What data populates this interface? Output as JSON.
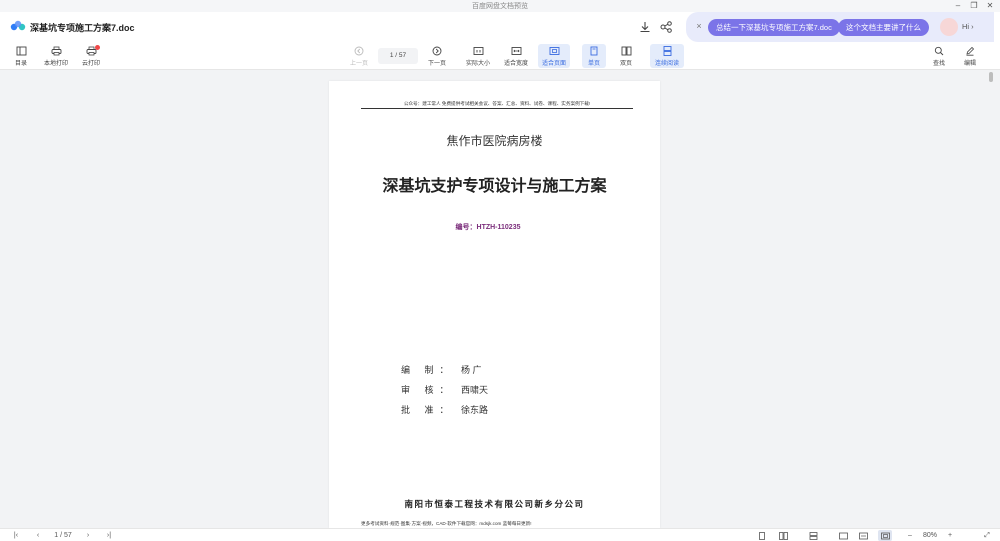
{
  "window": {
    "title": "百度网盘文档预览",
    "controls": {
      "minimize": "–",
      "restore": "❐",
      "close": "✕"
    }
  },
  "header": {
    "doc_title": "深基坑专项施工方案7.doc",
    "download_icon": "download-icon",
    "share_icon": "share-icon"
  },
  "ai": {
    "close": "×",
    "chip_summary": "总结一下深基坑专项施工方案7.doc",
    "chip_ask": "这个文档主要讲了什么",
    "hi": "Hi ›"
  },
  "toolbar": {
    "toc": "目录",
    "local_print": "本地打印",
    "cloud_print": "云打印",
    "prev_page": "上一页",
    "page_indicator": "1  /  57",
    "next_page": "下一页",
    "actual_size": "实际大小",
    "fit_width": "适合宽度",
    "fit_page": "适合页面",
    "single_page": "单页",
    "double_page": "双页",
    "continuous": "连续阅读",
    "find": "查找",
    "edit": "编辑"
  },
  "document": {
    "running_header": "公众号：建工常人  免费提供考试相关会议、答案、汇总、资料、试卷、课程、实务案例下载!",
    "subtitle": "焦作市医院病房楼",
    "main_title": "深基坑支护专项设计与施工方案",
    "code": "编号：HTZH-110235",
    "signatures": [
      {
        "role": "编 制：",
        "name": "杨  广"
      },
      {
        "role": "审 核：",
        "name": "西啸天"
      },
      {
        "role": "批 准：",
        "name": "徐东路"
      }
    ],
    "company": "南阳市恒泰工程技术有限公司新乡分公司",
    "footer": "更多考试资料·规范·图集·方案·视频，CAD·软件下载官网：mdsjk.com  蓝莓每日更新!"
  },
  "bottombar": {
    "first": "|‹",
    "prev": "‹",
    "page_indicator": "1  /  57",
    "next": "›",
    "last": "›|",
    "zoom_out": "–",
    "zoom": "80%",
    "zoom_in": "+",
    "expand": "⤢"
  },
  "colors": {
    "accent": "#3a6ce0",
    "ai_chip": "#7b74e8",
    "code_text": "#7b2d7b"
  }
}
